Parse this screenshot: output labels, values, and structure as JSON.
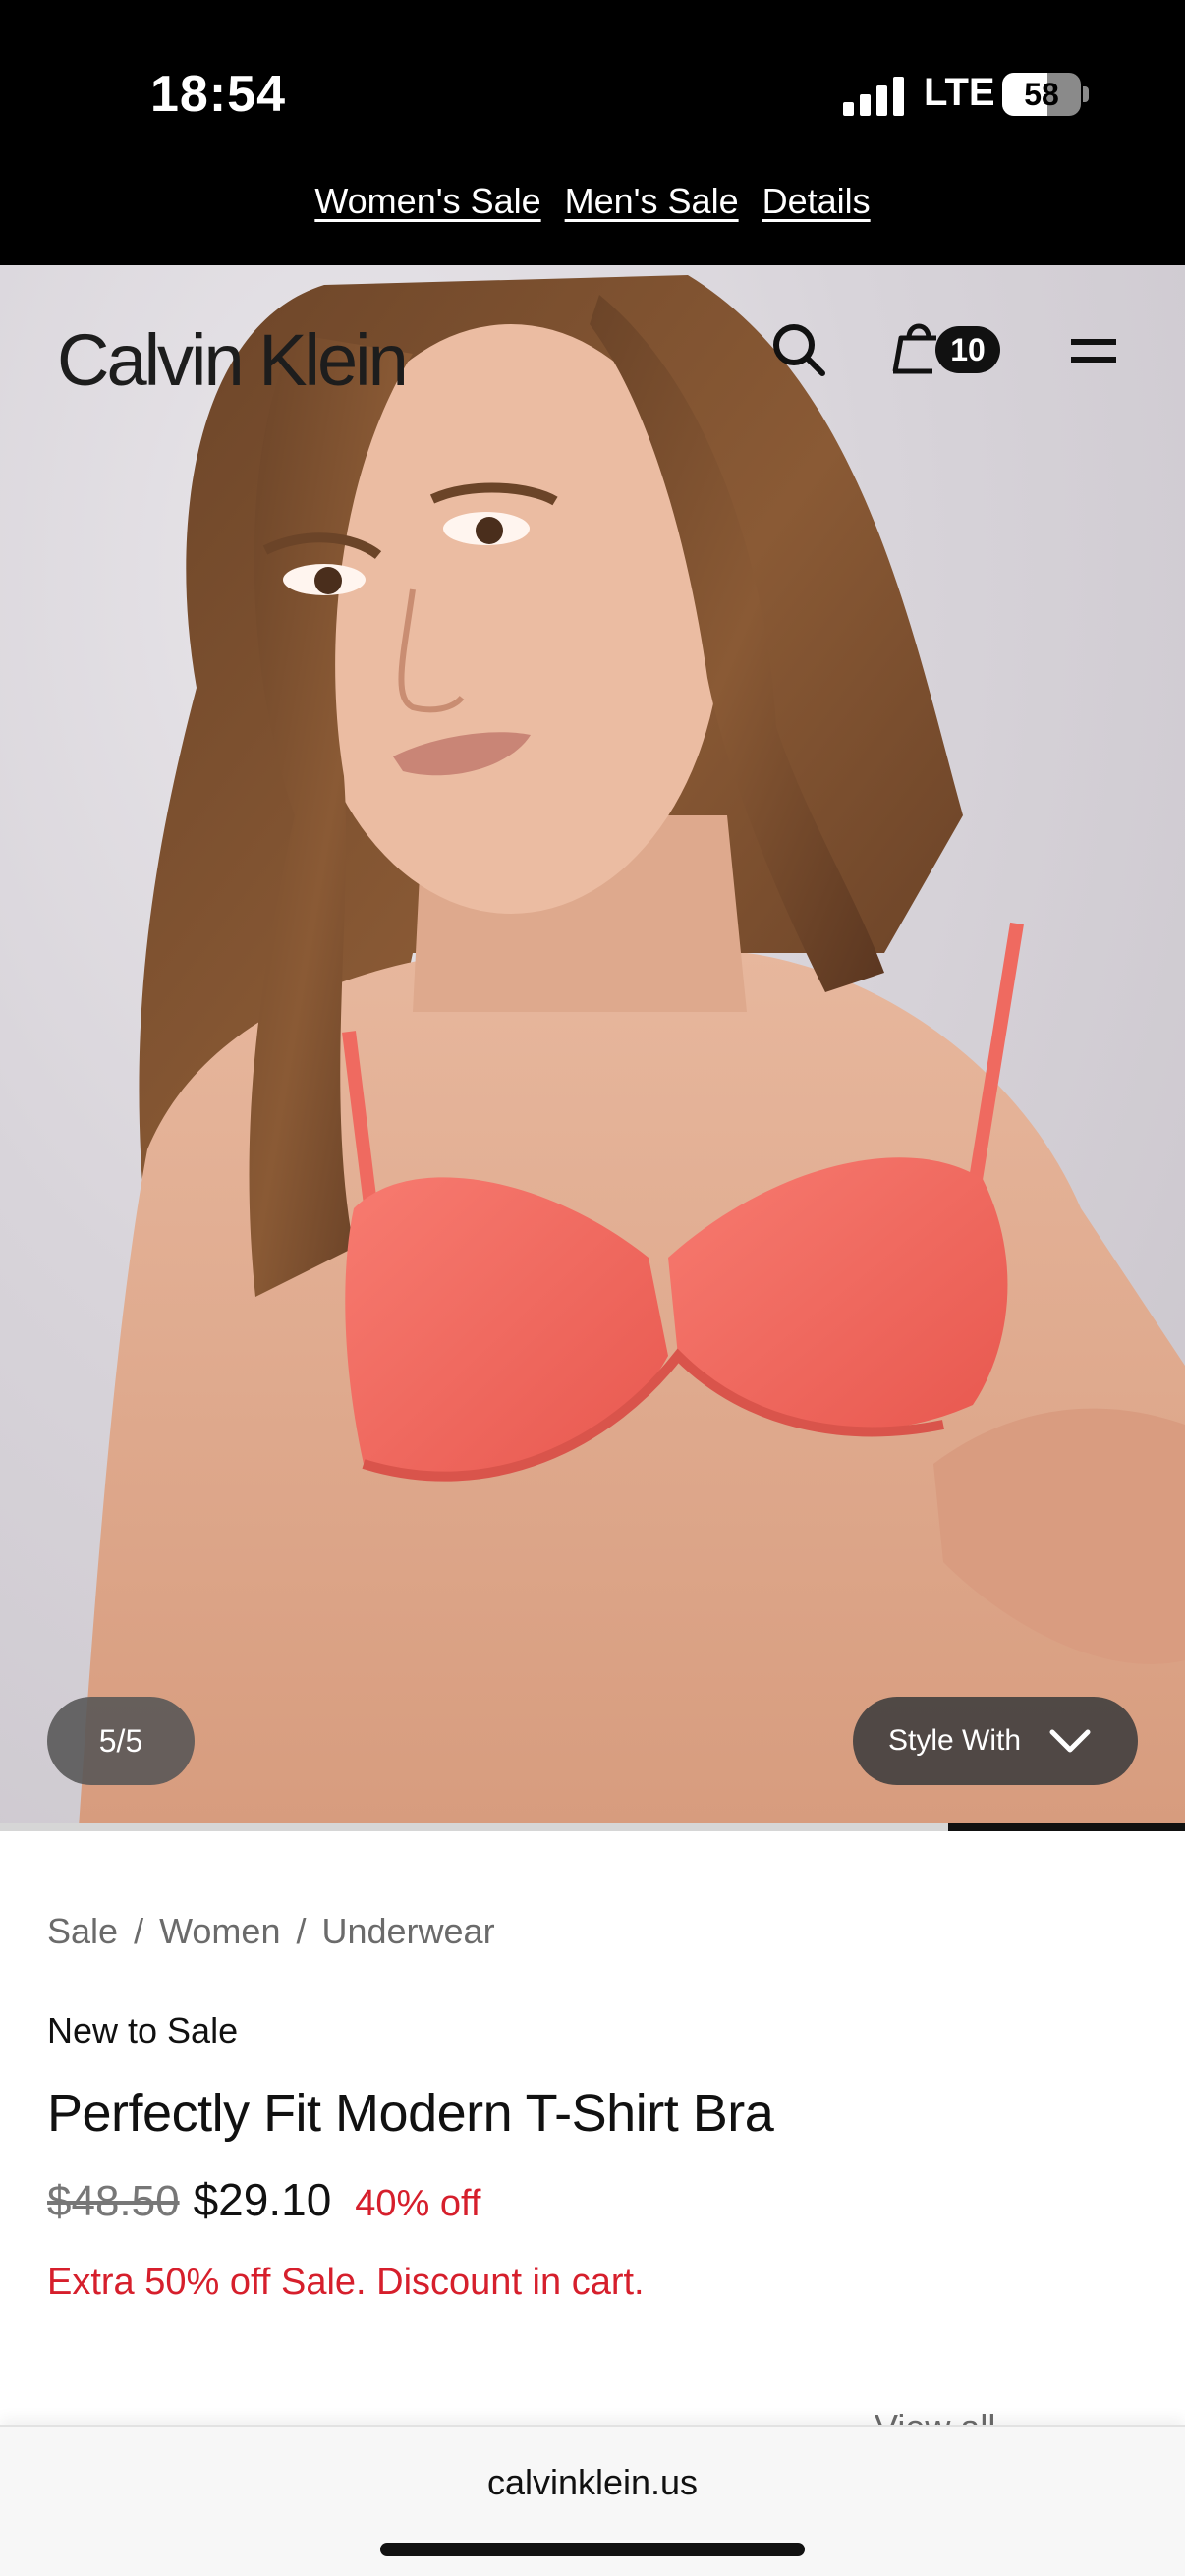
{
  "status_bar": {
    "time": "18:54",
    "network": "LTE",
    "battery": "58",
    "battery_level": 0.58
  },
  "promo_banner": {
    "links": [
      "Women's Sale",
      "Men's Sale",
      "Details"
    ]
  },
  "header": {
    "logo": "Calvin Klein",
    "cart_count": "10",
    "icons": [
      "search-icon",
      "shopping-bag-icon",
      "menu-icon"
    ]
  },
  "gallery": {
    "counter": "5/5",
    "style_with_label": "Style With",
    "current_index": 5,
    "total": 5
  },
  "product": {
    "breadcrumb": [
      "Sale",
      "Women",
      "Underwear"
    ],
    "badge": "New to Sale",
    "title": "Perfectly Fit Modern T-Shirt Bra",
    "price_original": "$48.50",
    "price_sale": "$29.10",
    "discount": "40% off",
    "promo_message": "Extra 50% off Sale. Discount in cart.",
    "view_all": "View all"
  },
  "browser": {
    "url": "calvinklein.us"
  },
  "colors": {
    "sale_red": "#d61f2c",
    "bra_coral": "#f2675f",
    "banner_black": "#000000"
  }
}
